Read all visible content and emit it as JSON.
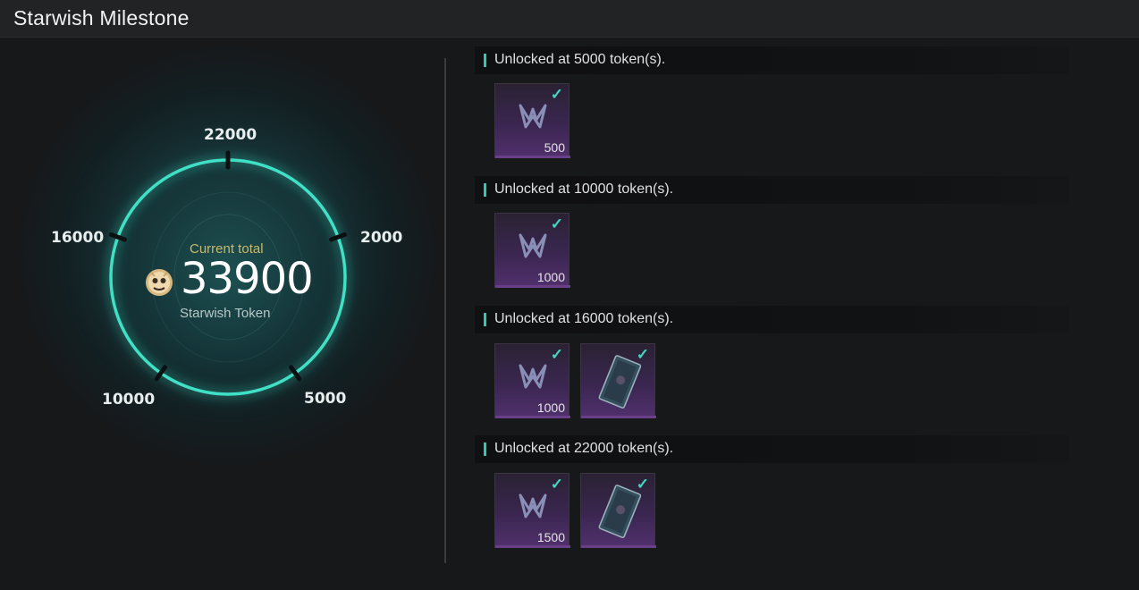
{
  "window": {
    "title": "Starwish Milestone"
  },
  "progress": {
    "current_label": "Current total",
    "total": "33900",
    "token_name": "Starwish Token",
    "token_icon": "starwish-token-icon",
    "accent_color": "#35d6bd",
    "milestones": [
      {
        "label": "22000"
      },
      {
        "label": "2000"
      },
      {
        "label": "5000"
      },
      {
        "label": "10000"
      },
      {
        "label": "16000"
      }
    ]
  },
  "tiers": [
    {
      "header": "Unlocked at 5000 token(s).",
      "rewards": [
        {
          "kind": "currency",
          "icon": "nexus-logo-icon",
          "qty": "500",
          "claimed": true
        }
      ]
    },
    {
      "header": "Unlocked at 10000 token(s).",
      "rewards": [
        {
          "kind": "currency",
          "icon": "nexus-logo-icon",
          "qty": "1000",
          "claimed": true
        }
      ]
    },
    {
      "header": "Unlocked at 16000 token(s).",
      "rewards": [
        {
          "kind": "currency",
          "icon": "nexus-logo-icon",
          "qty": "1000",
          "claimed": true
        },
        {
          "kind": "card",
          "icon": "card-item-icon",
          "qty": "",
          "claimed": true
        }
      ]
    },
    {
      "header": "Unlocked at 22000 token(s).",
      "rewards": [
        {
          "kind": "currency",
          "icon": "nexus-logo-icon",
          "qty": "1500",
          "claimed": true
        },
        {
          "kind": "card",
          "icon": "card-item-icon",
          "qty": "",
          "claimed": true
        }
      ]
    }
  ],
  "check_glyph": "✓"
}
